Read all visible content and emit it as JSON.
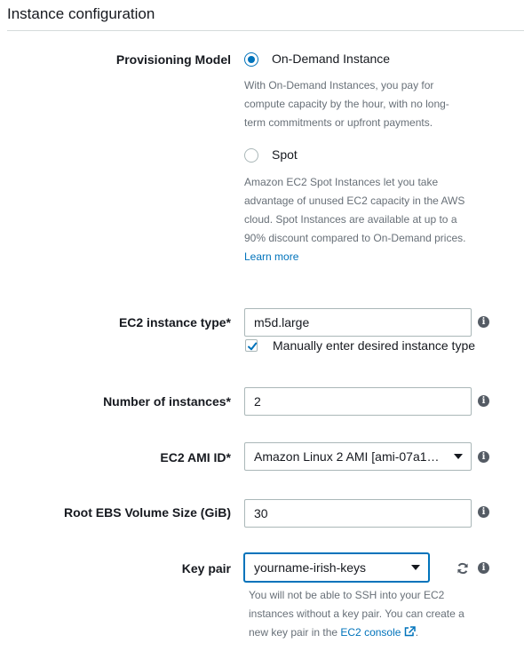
{
  "section": {
    "title": "Instance configuration"
  },
  "provisioning": {
    "label": "Provisioning Model",
    "on_demand": {
      "label": "On-Demand Instance",
      "checked": true,
      "desc_lines": [
        "With On-Demand Instances, you pay for",
        "compute capacity by the hour, with no long-",
        "term commitments or upfront payments."
      ]
    },
    "spot": {
      "label": "Spot",
      "checked": false,
      "desc_lines": [
        "Amazon EC2 Spot Instances let you take",
        "advantage of unused EC2 capacity in the AWS",
        "cloud. Spot Instances are available at up to a",
        "90% discount compared to On-Demand prices."
      ],
      "learn_more": "Learn more"
    }
  },
  "instance_type": {
    "label": "EC2 instance type*",
    "value": "m5d.large",
    "manual_checkbox_label": "Manually enter desired instance type",
    "manual_checked": true
  },
  "num_instances": {
    "label": "Number of instances*",
    "value": "2"
  },
  "ami": {
    "label": "EC2 AMI ID*",
    "value": "Amazon Linux 2 AMI [ami-07a1…"
  },
  "root_volume": {
    "label": "Root EBS Volume Size (GiB)",
    "value": "30"
  },
  "key_pair": {
    "label": "Key pair",
    "value": "yourname-irish-keys",
    "help_line1": "You will not be able to SSH into your EC2",
    "help_line2": "instances without a key pair. You can create a",
    "help_line3_prefix": "new key pair in the ",
    "help_link": "EC2 console",
    "help_line3_suffix": "."
  },
  "icons": {
    "info": "info-icon",
    "refresh": "refresh-icon",
    "external_link": "external-link-icon",
    "caret": "chevron-down-icon",
    "check": "check-icon"
  },
  "colors": {
    "accent": "#0073bb",
    "label_text": "#16191f",
    "muted_text": "#687078",
    "border": "#aab7b8"
  }
}
